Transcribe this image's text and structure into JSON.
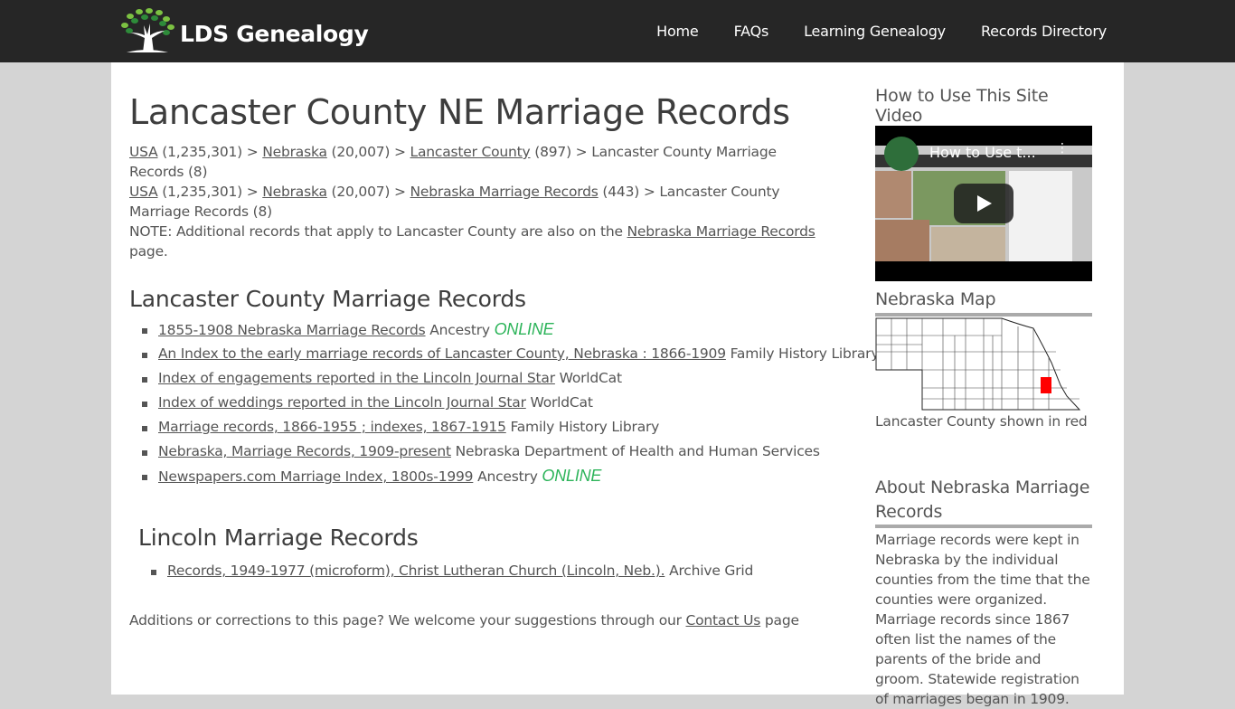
{
  "header": {
    "logo_text": "LDS Genealogy",
    "nav": [
      "Home",
      "FAQs",
      "Learning Genealogy",
      "Records Directory"
    ]
  },
  "main": {
    "title": "Lancaster County NE Marriage Records",
    "breadcrumbs": [
      {
        "items": [
          {
            "link": "USA",
            "count": "(1,235,301)"
          },
          {
            "link": "Nebraska",
            "count": "(20,007)"
          },
          {
            "link": "Lancaster County",
            "count": "(897)"
          }
        ],
        "current": "Lancaster County Marriage Records (8)"
      },
      {
        "items": [
          {
            "link": "USA",
            "count": "(1,235,301)"
          },
          {
            "link": "Nebraska",
            "count": "(20,007)"
          },
          {
            "link": "Nebraska Marriage Records",
            "count": "(443)"
          }
        ],
        "current": "Lancaster County Marriage Records (8)"
      }
    ],
    "separator": ">",
    "note": {
      "prefix": "NOTE: Additional records that apply to Lancaster County are also on the",
      "link": "Nebraska Marriage Records",
      "suffix": "page."
    },
    "section1": {
      "heading": "Lancaster County Marriage Records",
      "items": [
        {
          "link": "1855-1908 Nebraska Marriage Records",
          "source": "Ancestry",
          "badge": "ONLINE"
        },
        {
          "link": "An Index to the early marriage records of Lancaster County, Nebraska : 1866-1909",
          "source": "Family History Library",
          "badge": ""
        },
        {
          "link": "Index of engagements reported in the Lincoln Journal Star",
          "source": "WorldCat",
          "badge": ""
        },
        {
          "link": "Index of weddings reported in the Lincoln Journal Star",
          "source": "WorldCat",
          "badge": ""
        },
        {
          "link": "Marriage records, 1866-1955 ; indexes, 1867-1915",
          "source": "Family History Library",
          "badge": ""
        },
        {
          "link": "Nebraska, Marriage Records, 1909-present",
          "source": "Nebraska Department of Health and Human Services",
          "badge": ""
        },
        {
          "link": "Newspapers.com Marriage Index, 1800s-1999",
          "source": "Ancestry",
          "badge": "ONLINE"
        }
      ]
    },
    "section2": {
      "heading": "Lincoln Marriage Records",
      "items": [
        {
          "link": "Records, 1949-1977 (microform), Christ Lutheran Church (Lincoln, Neb.).",
          "source": "Archive Grid",
          "badge": ""
        }
      ]
    },
    "footer": {
      "prefix": "Additions or corrections to this page? We welcome your suggestions through our",
      "link": "Contact Us",
      "suffix": "page"
    }
  },
  "sidebar": {
    "video_title": "How to Use This Site Video",
    "video_caption": "How to Use t...",
    "map_title": "Nebraska Map",
    "map_caption": "Lancaster County shown in red",
    "about_title": "About Nebraska Marriage Records",
    "about_text": "Marriage records were kept in Nebraska by the individual counties from the time that the counties were organized. Marriage records since 1867 often list the names of the parents of the bride and groom. Statewide registration of marriages began in 1909."
  },
  "colors": {
    "header_bg": "#262626",
    "online": "#2db45a",
    "highlight_county": "#ff0000"
  }
}
